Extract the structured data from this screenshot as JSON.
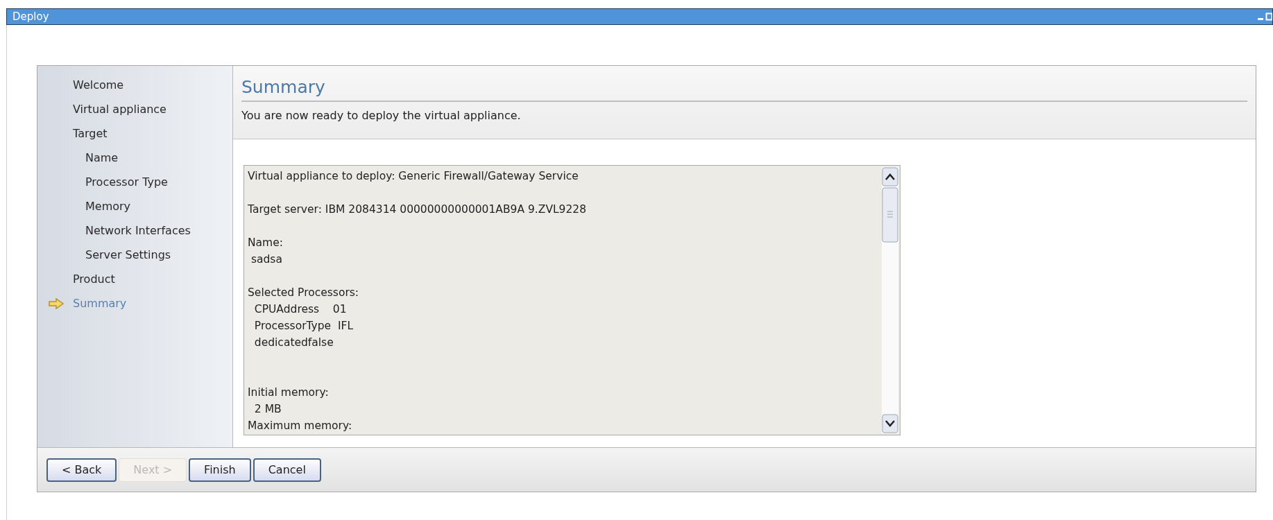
{
  "window": {
    "title": "Deploy"
  },
  "sidebar": {
    "items": [
      {
        "label": "Welcome",
        "selected": false
      },
      {
        "label": "Virtual appliance",
        "selected": false
      },
      {
        "label": "Target",
        "selected": false,
        "children": [
          {
            "label": "Name",
            "selected": false
          },
          {
            "label": "Processor Type",
            "selected": false
          },
          {
            "label": "Memory",
            "selected": false
          },
          {
            "label": "Network Interfaces",
            "selected": false
          },
          {
            "label": "Server Settings",
            "selected": false
          }
        ]
      },
      {
        "label": "Product",
        "selected": false
      },
      {
        "label": "Summary",
        "selected": true
      }
    ]
  },
  "header": {
    "title": "Summary",
    "description": "You are now ready to deploy the virtual appliance."
  },
  "summary_text": {
    "value": "Virtual appliance to deploy: Generic Firewall/Gateway Service\n\nTarget server: IBM 2084314 00000000000001AB9A 9.ZVL9228\n\nName:\n sadsa\n\nSelected Processors:\n  CPUAddress    01\n  ProcessorType  IFL\n  dedicatedfalse\n\n\nInitial memory:\n  2 MB\nMaximum memory:"
  },
  "buttons": [
    {
      "label": "< Back",
      "disabled": false
    },
    {
      "label": "Next >",
      "disabled": true
    },
    {
      "label": "Finish",
      "disabled": false
    },
    {
      "label": "Cancel",
      "disabled": false
    }
  ]
}
